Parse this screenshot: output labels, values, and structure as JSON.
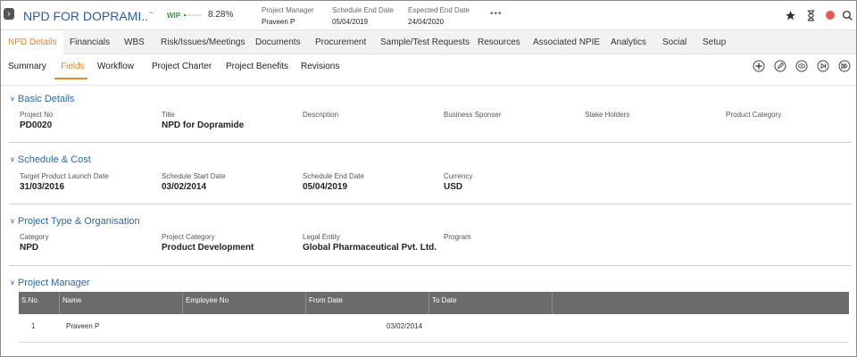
{
  "header": {
    "nav_toggle": "›",
    "title": "NPD FOR DOPRAMI..",
    "title_sup": "~",
    "status": "WIP",
    "progress_pct": 8.28,
    "progress_label": "8.28%",
    "meta": [
      {
        "label": "Project Manager",
        "value": "Praveen P"
      },
      {
        "label": "Schedule End Date",
        "value": "05/04/2019"
      },
      {
        "label": "Expected End Date",
        "value": "24/04/2020"
      }
    ],
    "more": "•••",
    "icons": [
      "star-icon",
      "hourglass-icon",
      "record-dot-icon",
      "search-icon"
    ],
    "colors": {
      "accent": "#e8862a",
      "link": "#2b5ea7",
      "status_green": "#2ea043",
      "record_red": "#f05454"
    }
  },
  "main_tabs": [
    "NPD Details",
    "Financials",
    "WBS",
    "Risk/Issues/Meetings",
    "Documents",
    "Procurement",
    "Sample/Test Requests",
    "Resources",
    "Associated NPIE",
    "Analytics",
    "Social",
    "Setup"
  ],
  "sub_tabs": [
    "Summary",
    "Fields",
    "Workflow",
    "Project Charter",
    "Project Benefits",
    "Revisions"
  ],
  "action_icons": [
    "add-icon",
    "edit-icon",
    "view-icon",
    "skip-next-icon",
    "fast-forward-icon"
  ],
  "sections": {
    "basic": {
      "title": "Basic Details",
      "fields": [
        {
          "label": "Project No",
          "value": "PD0020"
        },
        {
          "label": "Title",
          "value": "NPD for Dopramide"
        },
        {
          "label": "Description",
          "value": ""
        },
        {
          "label": "Business Sponser",
          "value": ""
        },
        {
          "label": "Stake Holders",
          "value": ""
        },
        {
          "label": "Product Category",
          "value": ""
        }
      ]
    },
    "schedule": {
      "title": "Schedule & Cost",
      "fields": [
        {
          "label": "Target Product Launch Date",
          "value": "31/03/2016"
        },
        {
          "label": "Schedule Start Date",
          "value": "03/02/2014"
        },
        {
          "label": "Schedule End Date",
          "value": "05/04/2019"
        },
        {
          "label": "Currency",
          "value": "USD"
        }
      ]
    },
    "type": {
      "title": "Project Type & Organisation",
      "fields": [
        {
          "label": "Category",
          "value": "NPD"
        },
        {
          "label": "Project Category",
          "value": "Product Development"
        },
        {
          "label": "Legal Entity",
          "value": "Global Pharmaceutical Pvt. Ltd."
        },
        {
          "label": "Program",
          "value": ""
        }
      ]
    },
    "manager": {
      "title": "Project Manager",
      "columns": [
        "S.No.",
        "Name",
        "Employee No",
        "From Date",
        "To Date"
      ],
      "rows": [
        {
          "sno": "1",
          "name": "Praveen P",
          "employee_no": "",
          "from_date": "03/02/2014",
          "to_date": ""
        }
      ]
    }
  }
}
